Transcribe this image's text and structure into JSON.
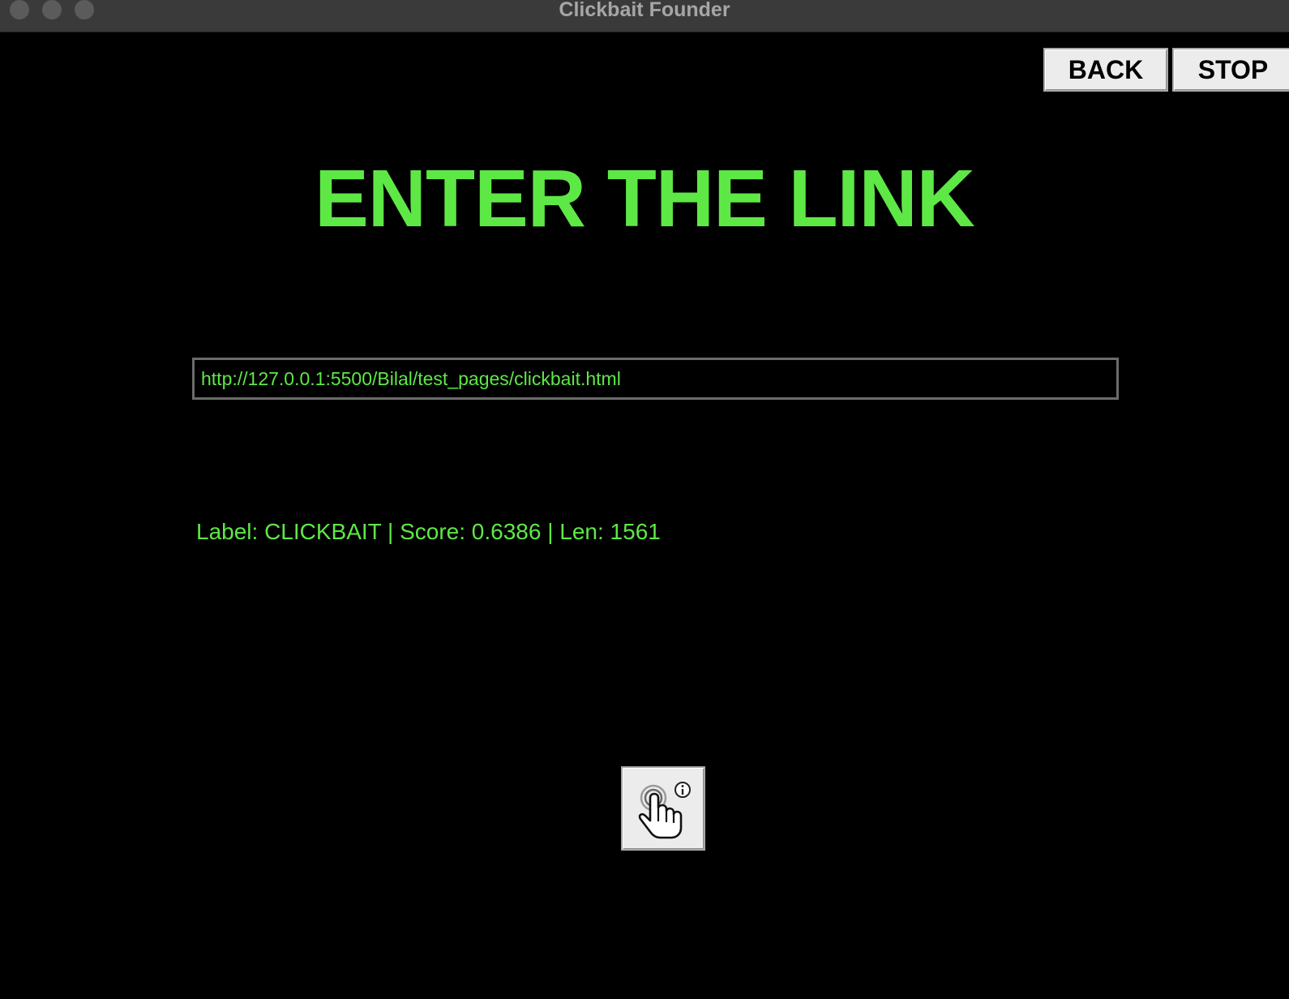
{
  "window": {
    "title": "Clickbait Founder"
  },
  "toolbar": {
    "back_label": "BACK",
    "stop_label": "STOP"
  },
  "main": {
    "heading": "ENTER THE LINK",
    "url_input": {
      "value": "http://127.0.0.1:5500/Bilal/test_pages/clickbait.html",
      "placeholder": ""
    },
    "result_text": "Label: CLICKBAIT | Score: 0.6386 | Len: 1561",
    "action_button": {
      "icon": "hand-pointer-click-icon"
    }
  },
  "colors": {
    "background": "#000000",
    "accent_green": "#5ee846",
    "titlebar": "#3a3a3a",
    "button_face": "#ececec"
  }
}
